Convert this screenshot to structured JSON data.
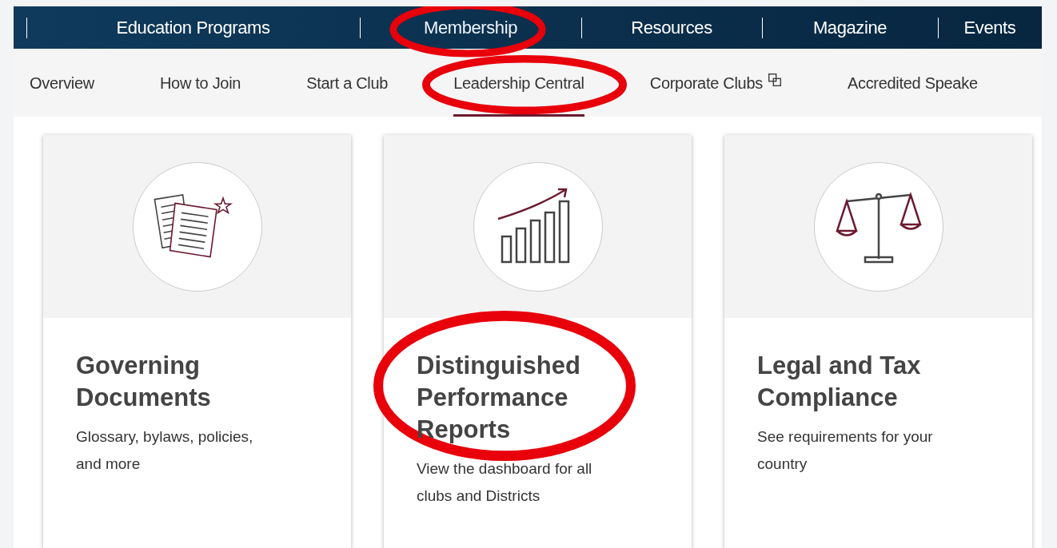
{
  "top_nav": [
    {
      "label": "Education Programs",
      "selected": false,
      "highlighted": false
    },
    {
      "label": "Membership",
      "selected": true,
      "highlighted": true
    },
    {
      "label": "Resources",
      "selected": false,
      "highlighted": false
    },
    {
      "label": "Magazine",
      "selected": false,
      "highlighted": false
    },
    {
      "label": "Events",
      "selected": false,
      "highlighted": false
    }
  ],
  "sub_nav": [
    {
      "label": "Overview",
      "selected": false,
      "highlighted": false,
      "external": false
    },
    {
      "label": "How to Join",
      "selected": false,
      "highlighted": false,
      "external": false
    },
    {
      "label": "Start a Club",
      "selected": false,
      "highlighted": false,
      "external": false
    },
    {
      "label": "Leadership Central",
      "selected": true,
      "highlighted": true,
      "external": false
    },
    {
      "label": "Corporate Clubs",
      "selected": false,
      "highlighted": false,
      "external": true
    },
    {
      "label": "Accredited Speake",
      "selected": false,
      "highlighted": false,
      "external": false
    }
  ],
  "cards": [
    {
      "kind": "documents",
      "title": "Governing Documents",
      "description": "Glossary, bylaws, policies, and more",
      "highlighted": false
    },
    {
      "kind": "chart",
      "title": "Distinguished Performance Reports",
      "description": "View the dashboard for all clubs and Districts",
      "highlighted": true
    },
    {
      "kind": "scales",
      "title": "Legal and Tax Compliance",
      "description": "See requirements for your country",
      "highlighted": false
    }
  ]
}
